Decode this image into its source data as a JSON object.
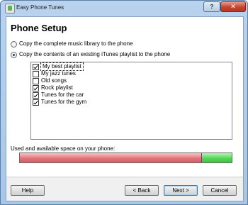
{
  "window": {
    "title": "Easy Phone Tunes",
    "help_glyph": "?",
    "close_glyph": "✕"
  },
  "page": {
    "title": "Phone Setup"
  },
  "options": [
    {
      "label": "Copy the complete music library to the phone",
      "selected": false
    },
    {
      "label": "Copy the contents of an existing iTunes playlist to the phone",
      "selected": true
    }
  ],
  "playlists": [
    {
      "label": "My best playlist",
      "checked": true,
      "focused": true
    },
    {
      "label": "My jazz tunes",
      "checked": false
    },
    {
      "label": "Old songs",
      "checked": false
    },
    {
      "label": "Rock playlist",
      "checked": true
    },
    {
      "label": "Tunes for the car",
      "checked": true
    },
    {
      "label": "Tunes for the gym",
      "checked": true
    }
  ],
  "space": {
    "label": "Used and available space on your phone:",
    "used_fraction": 0.86
  },
  "buttons": {
    "help": "Help",
    "back": "< Back",
    "next": "Next >",
    "cancel": "Cancel"
  },
  "colors": {
    "used": "#e2747a",
    "free": "#54d654",
    "title_bar": "#b9d3ee"
  }
}
